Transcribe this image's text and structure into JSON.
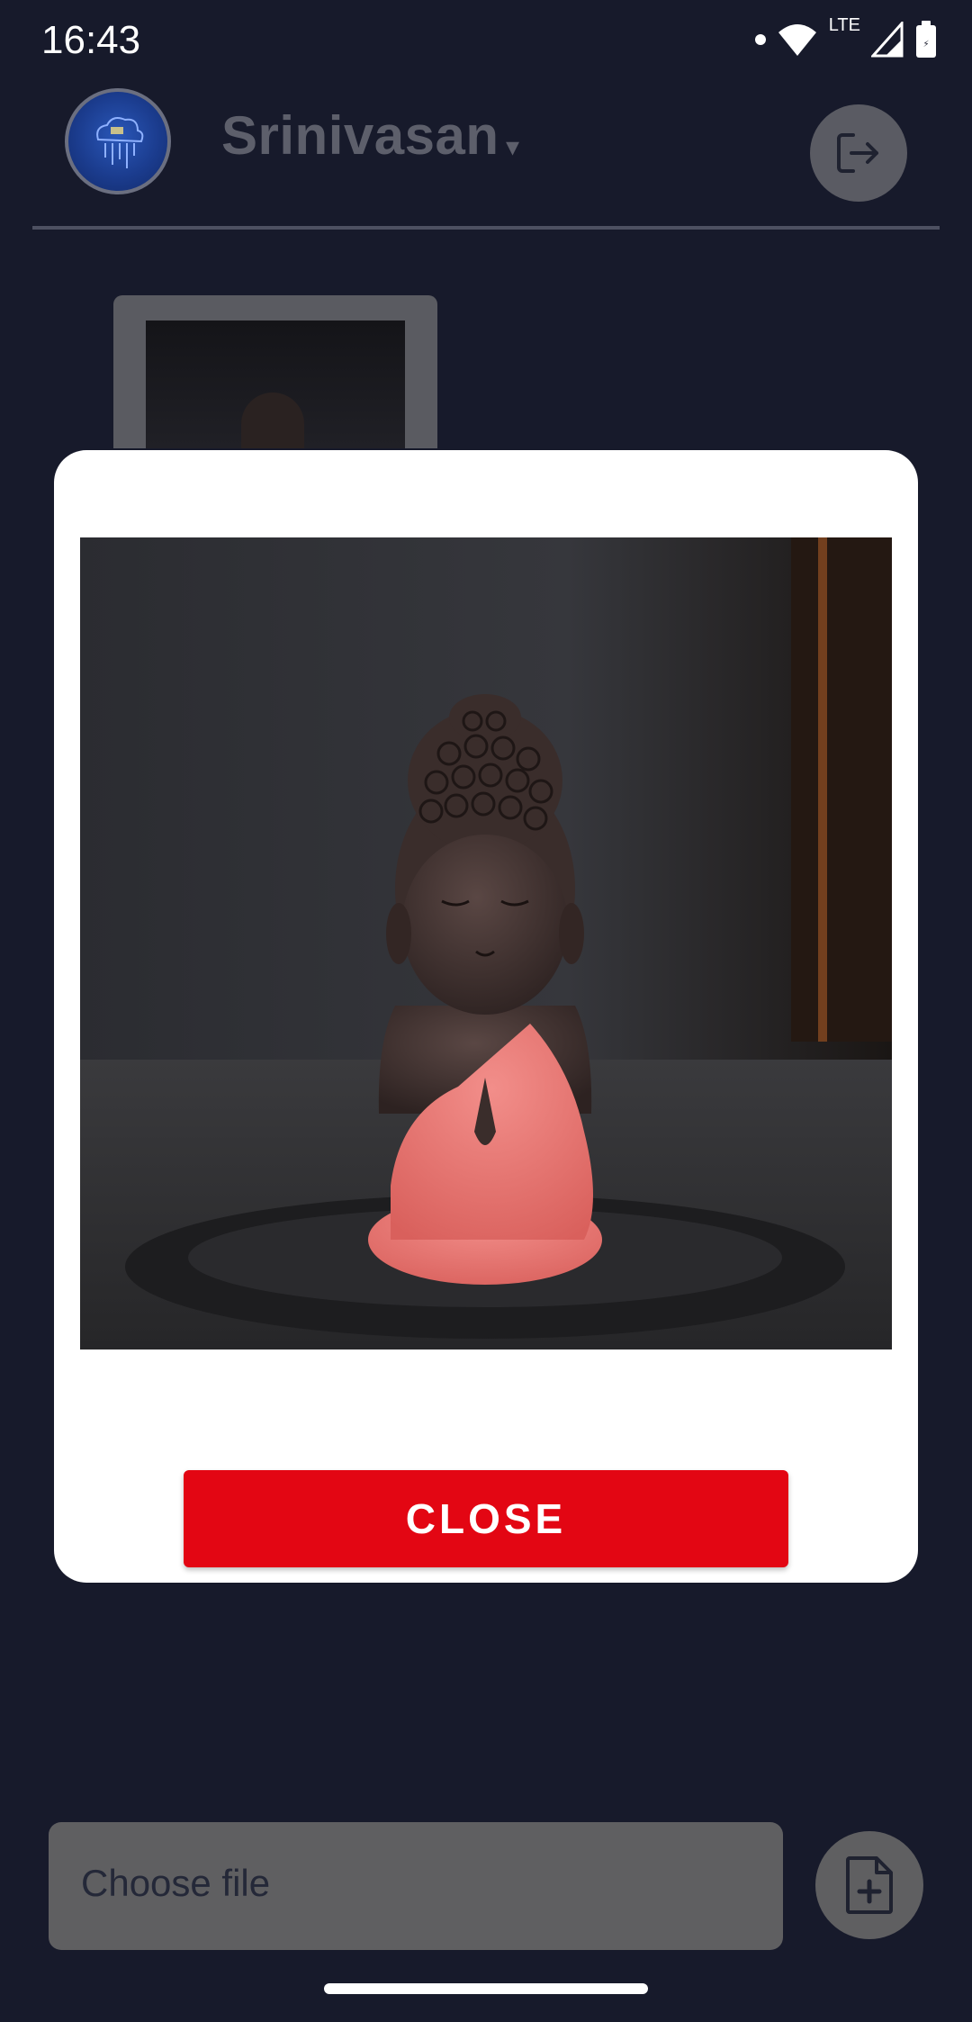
{
  "status_bar": {
    "time": "16:43",
    "network": "LTE",
    "icons": [
      "notification-dot-icon",
      "wifi-icon",
      "signal-icon",
      "battery-icon"
    ]
  },
  "header": {
    "username": "Srinivasan",
    "caret": "▾",
    "avatar_icon": "cloud-logo-icon",
    "logout_icon": "logout-icon"
  },
  "modal": {
    "close_label": "CLOSE",
    "image_description_icon": "buddha-statue-image"
  },
  "footer": {
    "choose_file_placeholder": "Choose file",
    "add_file_icon": "file-plus-icon"
  },
  "colors": {
    "background": "#171a2b",
    "accent_red": "#e30613",
    "muted_gray": "#5f5f61",
    "username_gray": "#5d5f6b",
    "modal_white": "#ffffff"
  }
}
